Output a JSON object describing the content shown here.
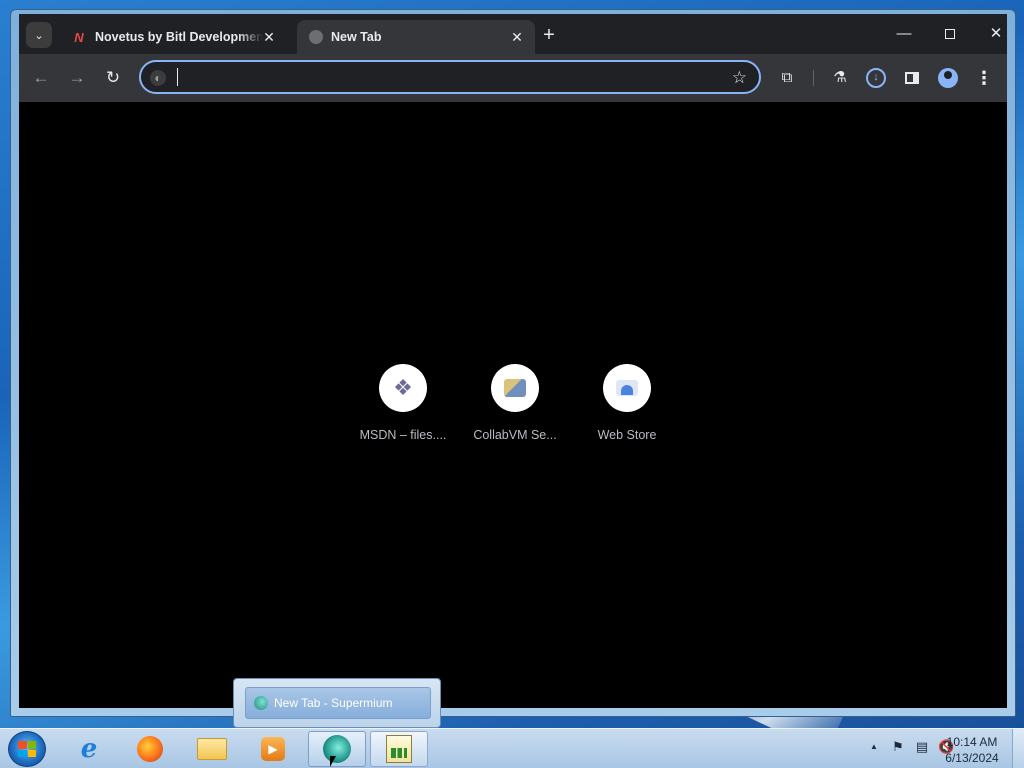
{
  "browser": {
    "tabs": [
      {
        "title": "Novetus by Bitl Development S",
        "favicon": "novetus-n-icon",
        "active": false
      },
      {
        "title": "New Tab",
        "favicon": "globe-icon",
        "active": true
      }
    ],
    "tab_close_glyph": "✕",
    "new_tab_glyph": "+",
    "window_controls": {
      "minimize": "—",
      "close": "✕"
    },
    "toolbar": {
      "back_glyph": "←",
      "forward_glyph": "→",
      "reload_glyph": "↻",
      "omnibox_value": "",
      "omnibox_placeholder": "",
      "star_glyph": "☆",
      "extensions_glyph": "⧉",
      "labs_glyph": "⚗",
      "download_glyph": "↓",
      "menu_glyph": "⋮"
    },
    "accent_color": "#8ab4f8"
  },
  "new_tab_page": {
    "background": "#000000",
    "shortcuts": [
      {
        "label": "MSDN – files....",
        "icon": "msdn-icon"
      },
      {
        "label": "CollabVM Se...",
        "icon": "collabvm-icon"
      },
      {
        "label": "Web Store",
        "icon": "web-store-icon"
      }
    ]
  },
  "taskbar": {
    "thumbnail_popup": {
      "title": "New Tab - Supermium"
    },
    "pinned_apps": [
      {
        "name": "Internet Explorer",
        "icon": "internet-explorer-icon"
      },
      {
        "name": "Firefox",
        "icon": "firefox-icon"
      },
      {
        "name": "Windows Explorer",
        "icon": "folder-icon"
      },
      {
        "name": "Windows Media Player",
        "icon": "media-player-icon"
      },
      {
        "name": "Supermium",
        "icon": "supermium-icon"
      },
      {
        "name": "Scratch",
        "icon": "scratch-icon"
      }
    ],
    "tray": {
      "show_hidden_glyph": "▲",
      "flag_glyph": "⚑",
      "network_glyph": "▤",
      "volume_glyph": "🔇"
    },
    "clock": {
      "time": "10:14 AM",
      "date": "6/13/2024"
    }
  }
}
